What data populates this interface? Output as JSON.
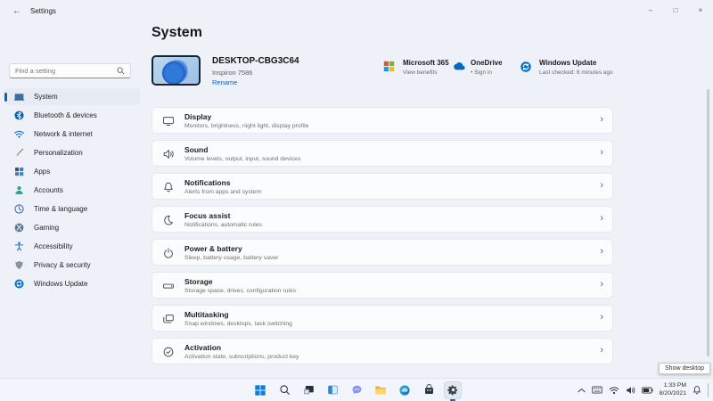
{
  "window": {
    "title": "Settings"
  },
  "icons": {
    "back": "←",
    "minimize": "–",
    "maximize": "□",
    "close": "×",
    "chevron_right": "›"
  },
  "sidebar": {
    "search_placeholder": "Find a setting",
    "items": [
      {
        "label": "System",
        "selected": true
      },
      {
        "label": "Bluetooth & devices",
        "selected": false
      },
      {
        "label": "Network & internet",
        "selected": false
      },
      {
        "label": "Personalization",
        "selected": false
      },
      {
        "label": "Apps",
        "selected": false
      },
      {
        "label": "Accounts",
        "selected": false
      },
      {
        "label": "Time & language",
        "selected": false
      },
      {
        "label": "Gaming",
        "selected": false
      },
      {
        "label": "Accessibility",
        "selected": false
      },
      {
        "label": "Privacy & security",
        "selected": false
      },
      {
        "label": "Windows Update",
        "selected": false
      }
    ]
  },
  "main": {
    "page_title": "System",
    "device": {
      "name": "DESKTOP-CBG3C64",
      "model": "Inspiron 7586",
      "rename_label": "Rename"
    },
    "status": [
      {
        "title": "Microsoft 365",
        "subtitle": "View benefits"
      },
      {
        "title": "OneDrive",
        "subtitle": "• Sign in"
      },
      {
        "title": "Windows Update",
        "subtitle": "Last checked: 6 minutes ago"
      }
    ],
    "rows": [
      {
        "title": "Display",
        "subtitle": "Monitors, brightness, night light, display profile"
      },
      {
        "title": "Sound",
        "subtitle": "Volume levels, output, input, sound devices"
      },
      {
        "title": "Notifications",
        "subtitle": "Alerts from apps and system"
      },
      {
        "title": "Focus assist",
        "subtitle": "Notifications, automatic rules"
      },
      {
        "title": "Power & battery",
        "subtitle": "Sleep, battery usage, battery saver"
      },
      {
        "title": "Storage",
        "subtitle": "Storage space, drives, configuration rules"
      },
      {
        "title": "Multitasking",
        "subtitle": "Snap windows, desktops, task switching"
      },
      {
        "title": "Activation",
        "subtitle": "Activation state, subscriptions, product key"
      }
    ]
  },
  "taskbar": {
    "tooltip": "Show desktop",
    "tray": {
      "time": "1:33 PM",
      "date": "8/20/2021"
    }
  },
  "colors": {
    "accent": "#0067c0",
    "window_bg": "#eef1f8",
    "card_bg": "#fbfcfe",
    "taskbar_bg": "#f2f5fb"
  }
}
